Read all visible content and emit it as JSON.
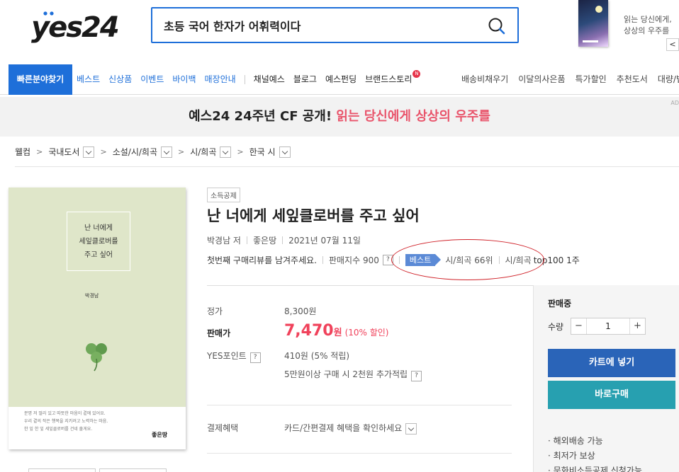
{
  "header": {
    "logo_text": "yes24",
    "search_value": "초등 국어 한자가 어휘력이다",
    "promo_text": "읽는 당신에게,\n상상의 우주를",
    "promo_prev": "<"
  },
  "nav": {
    "quick_label": "빠른분야찾기",
    "group1": [
      "베스트",
      "신상품",
      "이벤트",
      "바이백",
      "매장안내"
    ],
    "group2": [
      "채널예스",
      "블로그",
      "예스펀딩",
      "브랜드스토리"
    ],
    "new_badge": "N",
    "right": [
      "배송비채우기",
      "이달의사은품",
      "특가할인",
      "추천도서",
      "대량/법"
    ]
  },
  "banner": {
    "text_main": "예스24 24주년 CF 공개! ",
    "text_accent": "읽는 당신에게 상상의 우주를",
    "ad_mark": "AD",
    "accent_color": "#e9546b"
  },
  "breadcrumb": [
    "웰컴",
    "국내도서",
    "소설/시/희곡",
    "시/희곡",
    "한국 시"
  ],
  "cover": {
    "title": "난 너에게\n세잎클로버를\n주고 싶어",
    "author": "박경남",
    "blurb": "분명 저 멀리 있고 따뜻한 마음이 곁에 있어요.\n우리 곁의 작은 행복을 지키려고 노력하는 마음.\n한 잎 한 잎 세잎클로버를 건네 줄게요.",
    "publisher": "좋은땅"
  },
  "book": {
    "tag": "소득공제",
    "title": "난 너에게 세잎클로버를 주고 싶어",
    "author": "박경남 저",
    "publisher": "좋은땅",
    "date": "2021년 07월 11일",
    "review_prompt": "첫번째 구매리뷰를 남겨주세요.",
    "sales_index": "판매지수 900",
    "help": "?",
    "best_label": "베스트",
    "rank1": "시/희곡 66위",
    "rank2": "시/희곡",
    "rank2_suffix": "top100 1주"
  },
  "price": {
    "list_label": "정가",
    "list_value": "8,300원",
    "sale_label": "판매가",
    "sale_number": "7,470",
    "sale_unit": "원",
    "discount": "(10% 할인)",
    "points_label": "YES포인트",
    "points_value": "410원 (5% 적립)",
    "bonus": "5만원이상 구매 시 2천원 추가적립",
    "benefit_label": "결제혜택",
    "benefit_value": "카드/간편결제 혜택을 확인하세요"
  },
  "panel": {
    "status": "판매중",
    "qty_label": "수량",
    "qty_minus": "−",
    "qty_value": "1",
    "qty_plus": "+",
    "cart_button": "카트에 넣기",
    "buy_button": "바로구매",
    "notes": [
      "· 해외배송 가능",
      "· 최저가 보상",
      "· 문화비소득공제 신청가능"
    ]
  }
}
